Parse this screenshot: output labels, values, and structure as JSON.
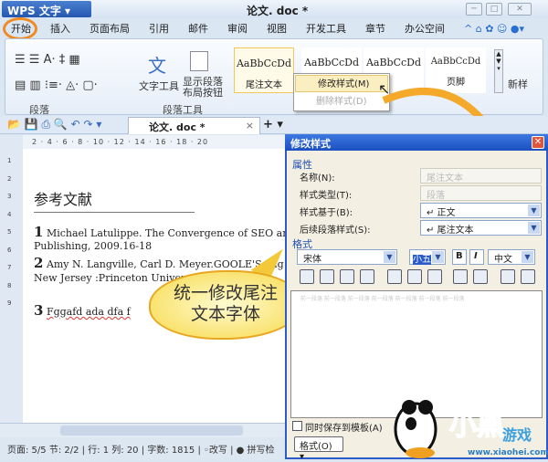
{
  "app": {
    "name": "WPS 文字",
    "doc_title": "论文. doc *"
  },
  "menu": [
    "开始",
    "插入",
    "页面布局",
    "引用",
    "邮件",
    "审阅",
    "视图",
    "开发工具",
    "章节",
    "办公空间"
  ],
  "ribbon": {
    "group_paragraph": "段落",
    "group_para_tools": "段落工具",
    "text_tools": "文字工具",
    "show_para_btn_1": "显示段落",
    "show_para_btn_2": "布局按钮",
    "new_style": "新样",
    "styles": [
      {
        "preview": "AaBbCcDd",
        "name": "尾注文本"
      },
      {
        "preview": "AaBbCcDd",
        "name": ""
      },
      {
        "preview": "AaBbCcDd",
        "name": ""
      },
      {
        "preview": "AaBbCcDd",
        "name": "页脚"
      }
    ]
  },
  "context_menu": {
    "modify": "修改样式(M)",
    "delete": "删除样式(D)"
  },
  "tab": {
    "label": "论文. doc *"
  },
  "ruler": "2 · 4 · 6 · 8 · 10 · 12 · 14 · 16 · 18 · 20",
  "document": {
    "heading": "参考文献",
    "refs": [
      {
        "num": "1",
        "line1": "Michael Latulippe. The Convergence of SEO and W",
        "line2": "Publishing, 2009.16-18"
      },
      {
        "num": "2",
        "line1": "Amy N. Langville, Carl D. Meyer.GOOLE'S Pag",
        "line2": "New Jersey :Princeton University Pr"
      },
      {
        "num": "3",
        "line1": "Fggafd ada dfa f",
        "line2": ""
      }
    ]
  },
  "status": {
    "text": "页面: 5/5  节: 2/2 | 行: 1  列: 20 | 字数: 1815 | ◦改写 | ● 拼写检"
  },
  "dialog": {
    "title": "修改样式",
    "section_props": "属性",
    "name_label": "名称(N):",
    "name_value": "尾注文本",
    "type_label": "样式类型(T):",
    "type_value": "段落",
    "based_label": "样式基于(B):",
    "based_value": "↵ 正文",
    "next_label": "后续段落样式(S):",
    "next_value": "↵ 尾注文本",
    "section_format": "格式",
    "font": "宋体",
    "size": "小五",
    "bold": "B",
    "italic": "I",
    "lang": "中文",
    "save_template": "同时保存到模板(A)",
    "format_button": "格式(O) ▾",
    "preview_text": "前一段落 前一段落 前一段落 前一段落 前一段落 前一段落 前一段落"
  },
  "callout": {
    "line1": "统一修改尾注",
    "line2": "文本字体"
  },
  "watermark": {
    "brand": "小黑游戏",
    "url": "www.xiaohei.com"
  }
}
